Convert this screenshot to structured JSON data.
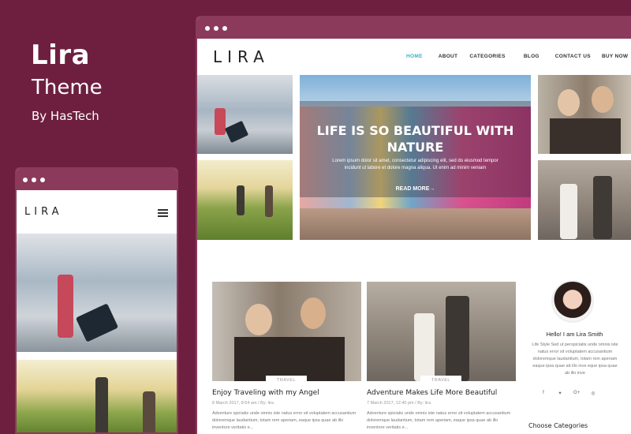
{
  "promo": {
    "title": "Lira",
    "subtitle": "Theme",
    "by": "By HasTech"
  },
  "desktop": {
    "logo": "LIRA",
    "nav": [
      "HOME",
      "ABOUT",
      "CATEGORIES",
      "BLOG",
      "CONTACT US",
      "BUY NOW"
    ],
    "active_nav": "HOME",
    "hero": {
      "title": "LIFE IS SO BEAUTIFUL WITH NATURE",
      "text": "Lorem ipsum dolor sit amet, consectetur adipiscing elit, sed do eiusmod tempor incidunt ut labore et dolore magna aliqua. Ut enim ad minim veniam",
      "more": "READ MORE→"
    },
    "cards": [
      {
        "tag": "TRAVEL",
        "title": "Enjoy Traveling with my Angel",
        "meta": "8 March 2017, 8:54 am / By: lira",
        "text": "Adventure spiciatis unde omnis iste natus error sit voluptatem accusantium doloremque laudantium, totam rem aperiam, eaque ipsa quae ab illo inventore veritatis e..."
      },
      {
        "tag": "TRAVEL",
        "title": "Adventure Makes Life More Beautiful",
        "meta": "7 March 2017, 12:40 pm / By: lira",
        "text": "Adventure spiciatis unde omnis iste natus error sit voluptatem accusantium doloremque laudantium, totam rem aperiam, eaque ipsa quae ab illo inventore veritatis e..."
      }
    ],
    "sidebar": {
      "name": "Hello! I am Lira Smith",
      "text": "Life Style Sed ut perspiciatis unde omnis iste natus error sit voluptatem accusantium doloremque laudantium, totam rem aperiam eaque ipsa quae ab illo inve eque ipsa quae ab illo inve",
      "social": [
        "f",
        "✦",
        "G+",
        "◎"
      ],
      "categories_heading": "Choose Categories"
    }
  },
  "mobile": {
    "logo": "LIRA"
  },
  "colors": {
    "background": "#6e1f3f",
    "frame": "#8b3a5c",
    "accent": "#36b3c4"
  }
}
